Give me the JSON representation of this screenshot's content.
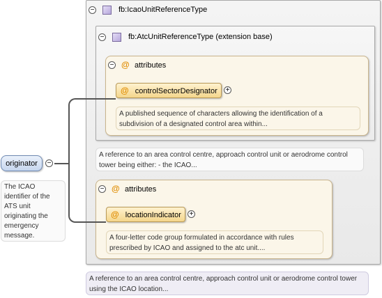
{
  "element": {
    "name": "originator",
    "documentation": "The ICAO identifier of the ATS unit originating the emergency message."
  },
  "outer_type": {
    "name": "fb:IcaoUnitReferenceType",
    "documentation": "A reference to an area control centre, approach control unit or aerodrome control tower using the ICAO location..."
  },
  "inner_type": {
    "name": "fb:AtcUnitReferenceType (extension base)",
    "documentation": "A reference to an area control centre, approach control unit or aerodrome control tower being either: - the ICAO..."
  },
  "attributes_label": "attributes",
  "attr1": {
    "name": "controlSectorDesignator",
    "documentation": "A published sequence of characters allowing the identification of a subdivision of a designated control area within..."
  },
  "attr2": {
    "name": "locationIndicator",
    "documentation": "A four-letter code group formulated in accordance with rules prescribed by ICAO and assigned to the atc unit...."
  },
  "symbols": {
    "collapse": "−",
    "expand": "+",
    "at": "@"
  }
}
